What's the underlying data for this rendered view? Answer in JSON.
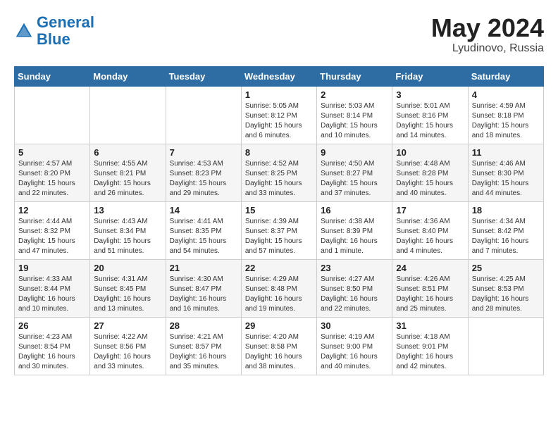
{
  "header": {
    "logo_line1": "General",
    "logo_line2": "Blue",
    "month": "May 2024",
    "location": "Lyudinovo, Russia"
  },
  "weekdays": [
    "Sunday",
    "Monday",
    "Tuesday",
    "Wednesday",
    "Thursday",
    "Friday",
    "Saturday"
  ],
  "weeks": [
    [
      {
        "day": "",
        "info": ""
      },
      {
        "day": "",
        "info": ""
      },
      {
        "day": "",
        "info": ""
      },
      {
        "day": "1",
        "info": "Sunrise: 5:05 AM\nSunset: 8:12 PM\nDaylight: 15 hours\nand 6 minutes."
      },
      {
        "day": "2",
        "info": "Sunrise: 5:03 AM\nSunset: 8:14 PM\nDaylight: 15 hours\nand 10 minutes."
      },
      {
        "day": "3",
        "info": "Sunrise: 5:01 AM\nSunset: 8:16 PM\nDaylight: 15 hours\nand 14 minutes."
      },
      {
        "day": "4",
        "info": "Sunrise: 4:59 AM\nSunset: 8:18 PM\nDaylight: 15 hours\nand 18 minutes."
      }
    ],
    [
      {
        "day": "5",
        "info": "Sunrise: 4:57 AM\nSunset: 8:20 PM\nDaylight: 15 hours\nand 22 minutes."
      },
      {
        "day": "6",
        "info": "Sunrise: 4:55 AM\nSunset: 8:21 PM\nDaylight: 15 hours\nand 26 minutes."
      },
      {
        "day": "7",
        "info": "Sunrise: 4:53 AM\nSunset: 8:23 PM\nDaylight: 15 hours\nand 29 minutes."
      },
      {
        "day": "8",
        "info": "Sunrise: 4:52 AM\nSunset: 8:25 PM\nDaylight: 15 hours\nand 33 minutes."
      },
      {
        "day": "9",
        "info": "Sunrise: 4:50 AM\nSunset: 8:27 PM\nDaylight: 15 hours\nand 37 minutes."
      },
      {
        "day": "10",
        "info": "Sunrise: 4:48 AM\nSunset: 8:28 PM\nDaylight: 15 hours\nand 40 minutes."
      },
      {
        "day": "11",
        "info": "Sunrise: 4:46 AM\nSunset: 8:30 PM\nDaylight: 15 hours\nand 44 minutes."
      }
    ],
    [
      {
        "day": "12",
        "info": "Sunrise: 4:44 AM\nSunset: 8:32 PM\nDaylight: 15 hours\nand 47 minutes."
      },
      {
        "day": "13",
        "info": "Sunrise: 4:43 AM\nSunset: 8:34 PM\nDaylight: 15 hours\nand 51 minutes."
      },
      {
        "day": "14",
        "info": "Sunrise: 4:41 AM\nSunset: 8:35 PM\nDaylight: 15 hours\nand 54 minutes."
      },
      {
        "day": "15",
        "info": "Sunrise: 4:39 AM\nSunset: 8:37 PM\nDaylight: 15 hours\nand 57 minutes."
      },
      {
        "day": "16",
        "info": "Sunrise: 4:38 AM\nSunset: 8:39 PM\nDaylight: 16 hours\nand 1 minute."
      },
      {
        "day": "17",
        "info": "Sunrise: 4:36 AM\nSunset: 8:40 PM\nDaylight: 16 hours\nand 4 minutes."
      },
      {
        "day": "18",
        "info": "Sunrise: 4:34 AM\nSunset: 8:42 PM\nDaylight: 16 hours\nand 7 minutes."
      }
    ],
    [
      {
        "day": "19",
        "info": "Sunrise: 4:33 AM\nSunset: 8:44 PM\nDaylight: 16 hours\nand 10 minutes."
      },
      {
        "day": "20",
        "info": "Sunrise: 4:31 AM\nSunset: 8:45 PM\nDaylight: 16 hours\nand 13 minutes."
      },
      {
        "day": "21",
        "info": "Sunrise: 4:30 AM\nSunset: 8:47 PM\nDaylight: 16 hours\nand 16 minutes."
      },
      {
        "day": "22",
        "info": "Sunrise: 4:29 AM\nSunset: 8:48 PM\nDaylight: 16 hours\nand 19 minutes."
      },
      {
        "day": "23",
        "info": "Sunrise: 4:27 AM\nSunset: 8:50 PM\nDaylight: 16 hours\nand 22 minutes."
      },
      {
        "day": "24",
        "info": "Sunrise: 4:26 AM\nSunset: 8:51 PM\nDaylight: 16 hours\nand 25 minutes."
      },
      {
        "day": "25",
        "info": "Sunrise: 4:25 AM\nSunset: 8:53 PM\nDaylight: 16 hours\nand 28 minutes."
      }
    ],
    [
      {
        "day": "26",
        "info": "Sunrise: 4:23 AM\nSunset: 8:54 PM\nDaylight: 16 hours\nand 30 minutes."
      },
      {
        "day": "27",
        "info": "Sunrise: 4:22 AM\nSunset: 8:56 PM\nDaylight: 16 hours\nand 33 minutes."
      },
      {
        "day": "28",
        "info": "Sunrise: 4:21 AM\nSunset: 8:57 PM\nDaylight: 16 hours\nand 35 minutes."
      },
      {
        "day": "29",
        "info": "Sunrise: 4:20 AM\nSunset: 8:58 PM\nDaylight: 16 hours\nand 38 minutes."
      },
      {
        "day": "30",
        "info": "Sunrise: 4:19 AM\nSunset: 9:00 PM\nDaylight: 16 hours\nand 40 minutes."
      },
      {
        "day": "31",
        "info": "Sunrise: 4:18 AM\nSunset: 9:01 PM\nDaylight: 16 hours\nand 42 minutes."
      },
      {
        "day": "",
        "info": ""
      }
    ]
  ]
}
